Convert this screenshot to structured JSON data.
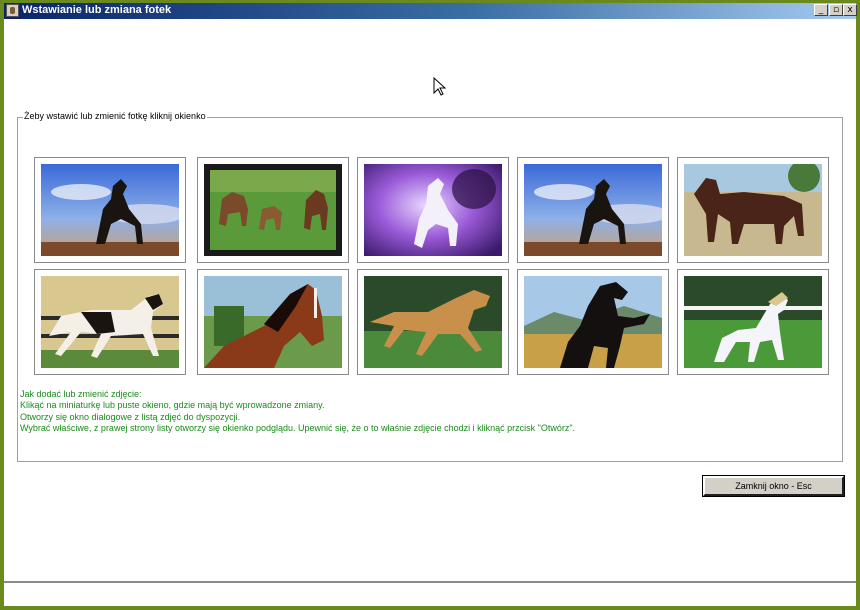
{
  "window": {
    "title": "Wstawianie lub zmiana fotek",
    "controls": {
      "minimize": "_",
      "restore": "▫",
      "close": "x"
    }
  },
  "group": {
    "label": "Żeby wstawić lub zmienić fotkę kliknij okienko"
  },
  "thumbnails": [
    {
      "icon": "horse-rearing-dark-sky-photo"
    },
    {
      "icon": "three-horses-meadow-photo"
    },
    {
      "icon": "white-horse-purple-fantasy-photo"
    },
    {
      "icon": "horse-rearing-dark-sky-photo"
    },
    {
      "icon": "draft-horse-brown-photo"
    },
    {
      "icon": "pinto-horse-running-photo"
    },
    {
      "icon": "chestnut-horse-portrait-photo"
    },
    {
      "icon": "palomino-horse-galloping-photo"
    },
    {
      "icon": "black-horse-rearing-photo"
    },
    {
      "icon": "white-pony-paddock-photo"
    }
  ],
  "instructions": {
    "lines": [
      "Jak dodać lub zmienić zdjęcie:",
      "Klikąć na miniaturkę lub puste okieno, gdzie mają być wprowadzone zmiany.",
      "Otworzy się okno dialogowe z listą zdjęć do dyspozycji.",
      "Wybrać właściwe, z prawej strony listy otworzy się okienko podglądu. Upewnić się, że o to właśnie zdjęcie chodzi i kliknąć przcisk \"Otwórz\"."
    ]
  },
  "buttons": {
    "close_label": "Zamknij okno - Esc"
  },
  "colors": {
    "titlebar_start": "#0a246a",
    "titlebar_end": "#a6caf0",
    "instruction_text": "#1a8a1a",
    "window_frame": "#6b8a1e"
  }
}
